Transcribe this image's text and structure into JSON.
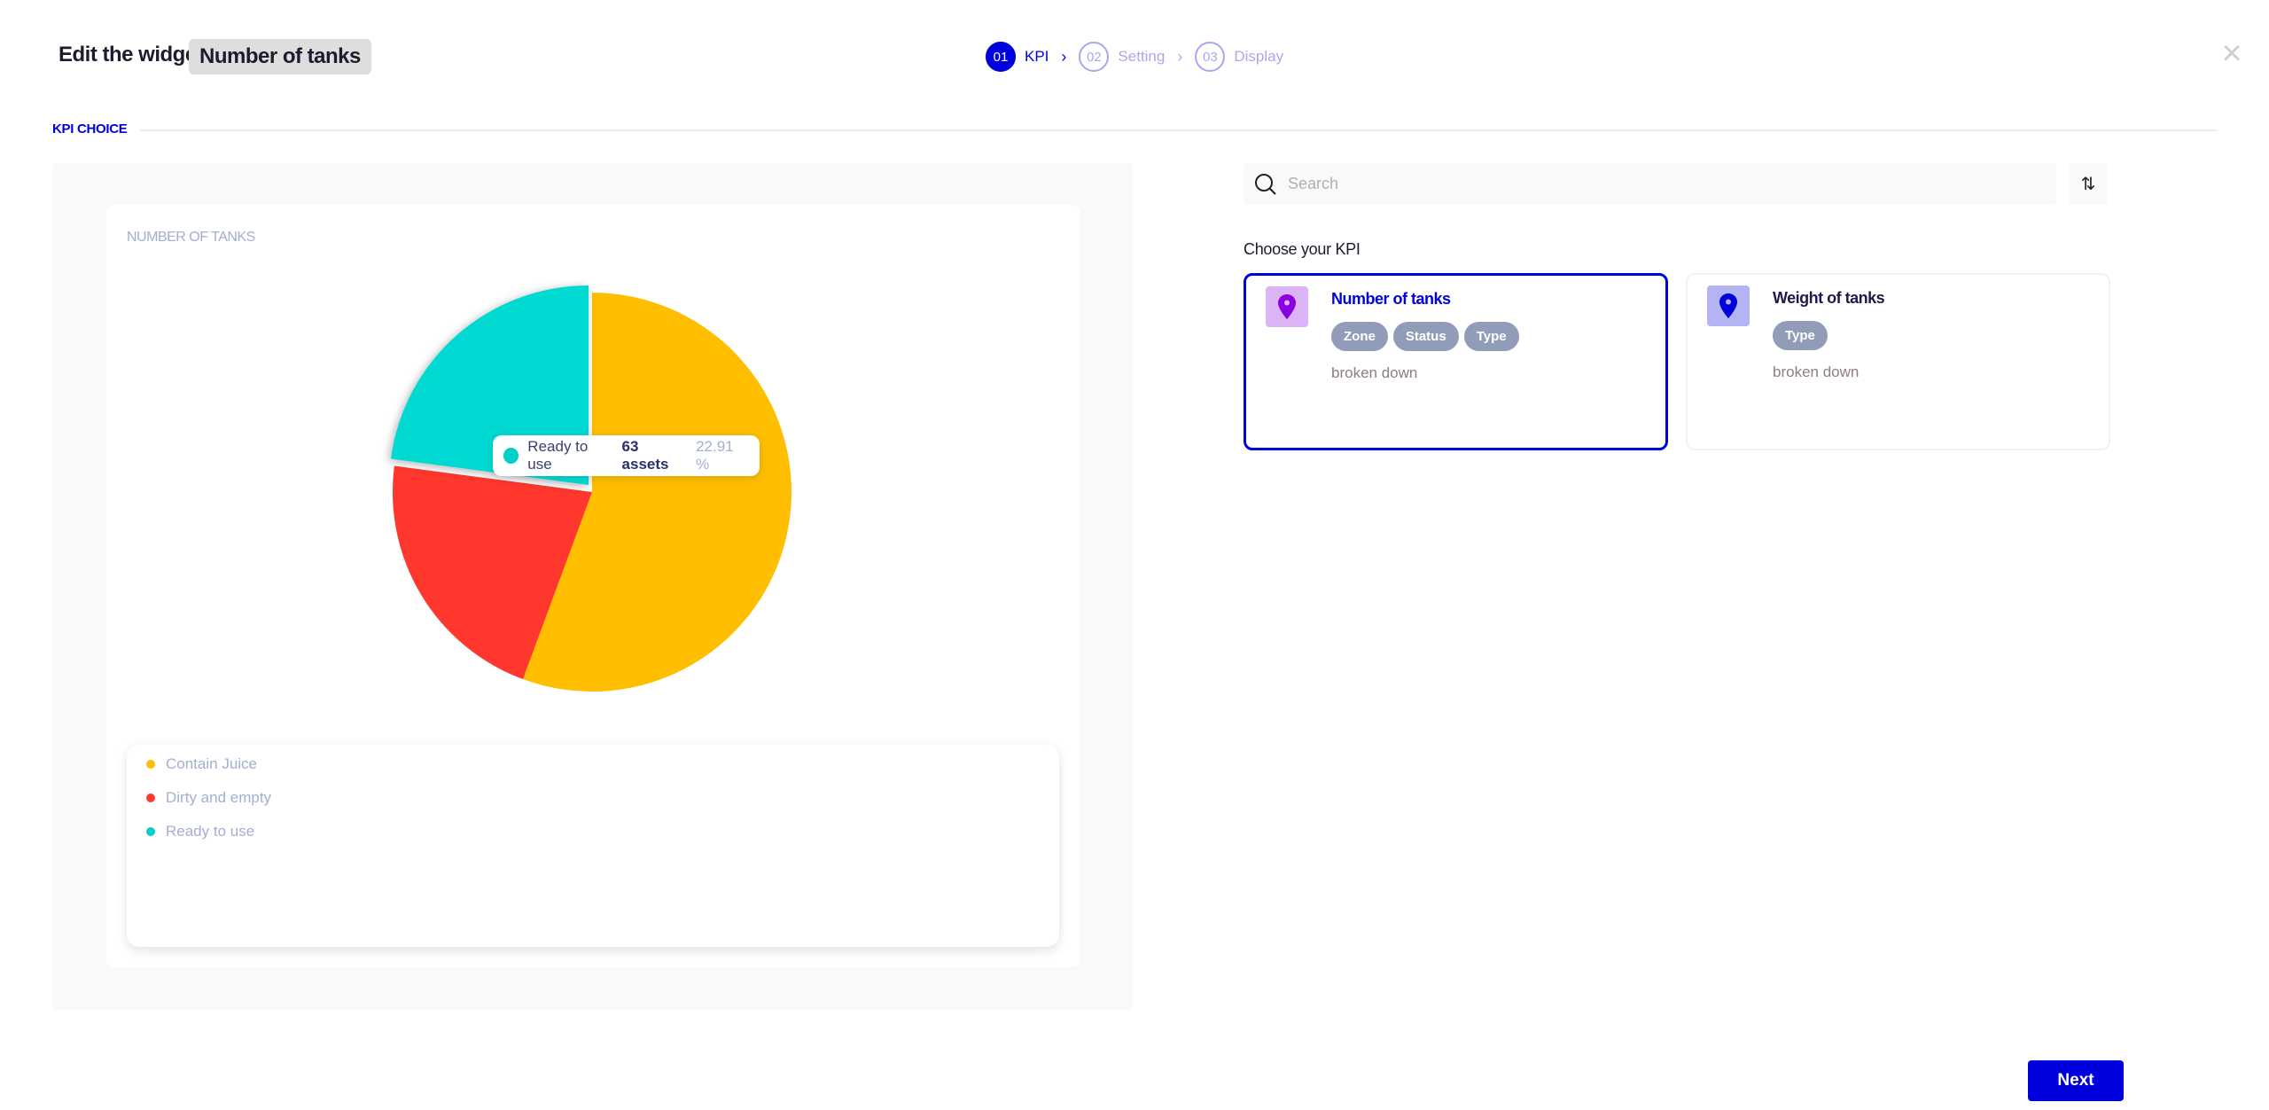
{
  "header": {
    "title": "Edit the widget",
    "widget_name": "Number of tanks",
    "close_icon": "close-x-icon"
  },
  "stepper": {
    "steps": [
      {
        "number": "01",
        "label": "KPI",
        "active": true
      },
      {
        "number": "02",
        "label": "Setting",
        "active": false
      },
      {
        "number": "03",
        "label": "Display",
        "active": false
      }
    ]
  },
  "section_title": "KPI CHOICE",
  "preview": {
    "card_title": "NUMBER OF TANKS",
    "tooltip": {
      "label": "Ready to use",
      "count": "63 assets",
      "percent": "22.91 %"
    }
  },
  "chart_data": {
    "type": "pie",
    "title": "NUMBER OF TANKS",
    "legend_position": "bottom",
    "categories": [
      "Contain Juice",
      "Dirty and empty",
      "Ready to use"
    ],
    "values": [
      153,
      59,
      63
    ],
    "colors": [
      "#ffbe00",
      "#ff372d",
      "#00d9d2"
    ],
    "highlighted": "Ready to use"
  },
  "search": {
    "placeholder": "Search",
    "value": ""
  },
  "kpi": {
    "heading": "Choose your KPI",
    "cards": [
      {
        "name": "Number of tanks",
        "tags": [
          "Zone",
          "Status",
          "Type"
        ],
        "subtitle": "broken down",
        "selected": true,
        "icon_bg": "#dcb4f5",
        "icon_color": "#8a00e0",
        "name_color": "#0000dc"
      },
      {
        "name": "Weight of tanks",
        "tags": [
          "Type"
        ],
        "subtitle": "broken down",
        "selected": false,
        "icon_bg": "#b4b4f5",
        "icon_color": "#0000dc",
        "name_color": "#1c1c4c"
      }
    ]
  },
  "footer": {
    "next_label": "Next"
  },
  "colors": {
    "accent": "#0000dc"
  }
}
